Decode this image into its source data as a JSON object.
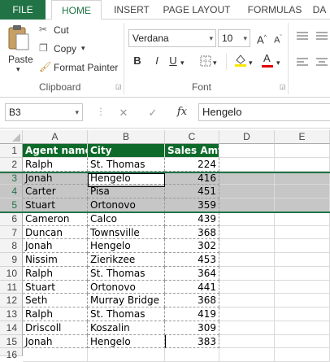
{
  "tabs": [
    "FILE",
    "HOME",
    "INSERT",
    "PAGE LAYOUT",
    "FORMULAS",
    "DA"
  ],
  "clipboard": {
    "paste": "Paste",
    "cut": "Cut",
    "copy": "Copy",
    "format_painter": "Format Painter",
    "group": "Clipboard"
  },
  "font": {
    "name": "Verdana",
    "size": "10",
    "group": "Font",
    "bold": "B",
    "italic": "I",
    "underline": "U"
  },
  "formula_bar": {
    "name_box": "B3",
    "cancel": "✕",
    "enter": "✓",
    "fx": "fx",
    "value": "Hengelo"
  },
  "columns": [
    "A",
    "B",
    "C",
    "D",
    "E"
  ],
  "rows": [
    "1",
    "2",
    "3",
    "4",
    "5",
    "6",
    "7",
    "8",
    "9",
    "10",
    "11",
    "12",
    "13",
    "14",
    "15",
    "16"
  ],
  "table": {
    "headers": [
      "Agent name",
      "City",
      "Sales Amt"
    ],
    "data": [
      [
        "Ralph",
        "St. Thomas",
        "224"
      ],
      [
        "Jonah",
        "Hengelo",
        "416"
      ],
      [
        "Carter",
        "Pisa",
        "451"
      ],
      [
        "Stuart",
        "Ortonovo",
        "359"
      ],
      [
        "Cameron",
        "Calco",
        "439"
      ],
      [
        "Duncan",
        "Townsville",
        "368"
      ],
      [
        "Jonah",
        "Hengelo",
        "302"
      ],
      [
        "Nissim",
        "Zierikzee",
        "453"
      ],
      [
        "Ralph",
        "St. Thomas",
        "364"
      ],
      [
        "Stuart",
        "Ortonovo",
        "441"
      ],
      [
        "Seth",
        "Murray Bridge",
        "368"
      ],
      [
        "Ralph",
        "St. Thomas",
        "419"
      ],
      [
        "Driscoll",
        "Koszalin",
        "309"
      ],
      [
        "Jonah",
        "Hengelo",
        "383"
      ]
    ]
  },
  "colors": {
    "excel_green": "#217346",
    "header_fill": "#0e6a2a",
    "selection": "#c6c6c6"
  }
}
